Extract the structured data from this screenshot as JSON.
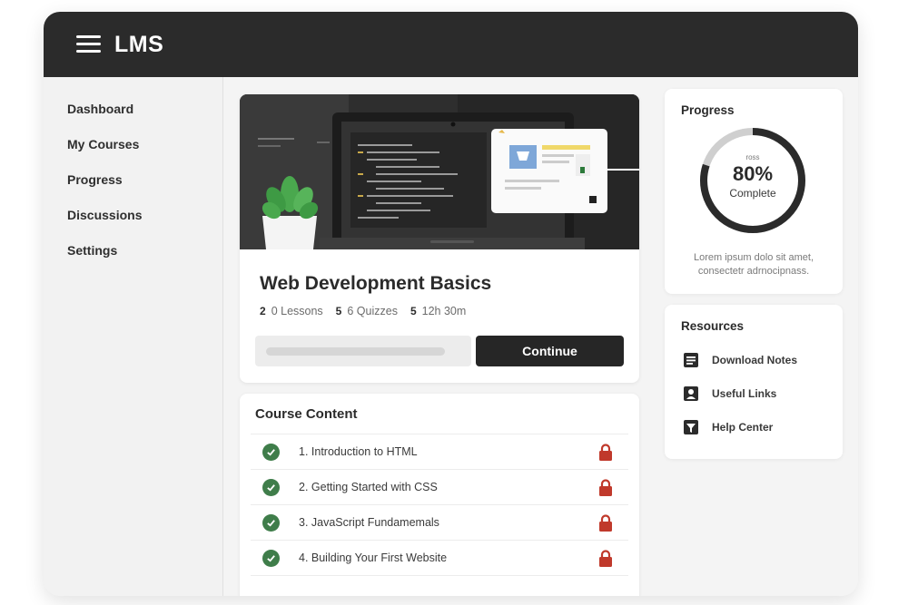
{
  "header": {
    "brand": "LMS"
  },
  "sidebar": {
    "items": [
      {
        "label": "Dashboard"
      },
      {
        "label": "My Courses"
      },
      {
        "label": "Progress"
      },
      {
        "label": "Discussions"
      },
      {
        "label": "Settings"
      }
    ]
  },
  "course": {
    "title": "Web Development Basics",
    "meta": [
      {
        "prefix": "2",
        "text": "0 Lessons"
      },
      {
        "prefix": "5",
        "text": "6 Quizzes"
      },
      {
        "prefix": "5",
        "text": "12h 30m"
      }
    ],
    "progress_fraction": 0.92,
    "continue_label": "Continue"
  },
  "content": {
    "title": "Course Content",
    "lessons": [
      {
        "label": "1. Introduction to HTML"
      },
      {
        "label": "2. Getting Started with CSS"
      },
      {
        "label": "3. JavaScript Fundamemals"
      },
      {
        "label": "4. Building Your First Website"
      }
    ]
  },
  "progress_panel": {
    "title": "Progress",
    "ring_small": "ross",
    "percent_label": "80%",
    "percent_value": 0.8,
    "complete_label": "Complete",
    "description": "Lorem ipsum dolo sit amet, consectetr adrnocipnass."
  },
  "resources": {
    "title": "Resources",
    "items": [
      {
        "label": "Download Notes",
        "icon": "document-icon"
      },
      {
        "label": "Useful Links",
        "icon": "bookmark-icon"
      },
      {
        "label": "Help Center",
        "icon": "help-icon"
      }
    ]
  },
  "colors": {
    "header_bg": "#2b2b2b",
    "check_green": "#3f7d4a",
    "lock_red": "#c0392b",
    "button_dark": "#262626",
    "ring_dark": "#2b2b2b",
    "ring_light": "#cfcfcf"
  }
}
